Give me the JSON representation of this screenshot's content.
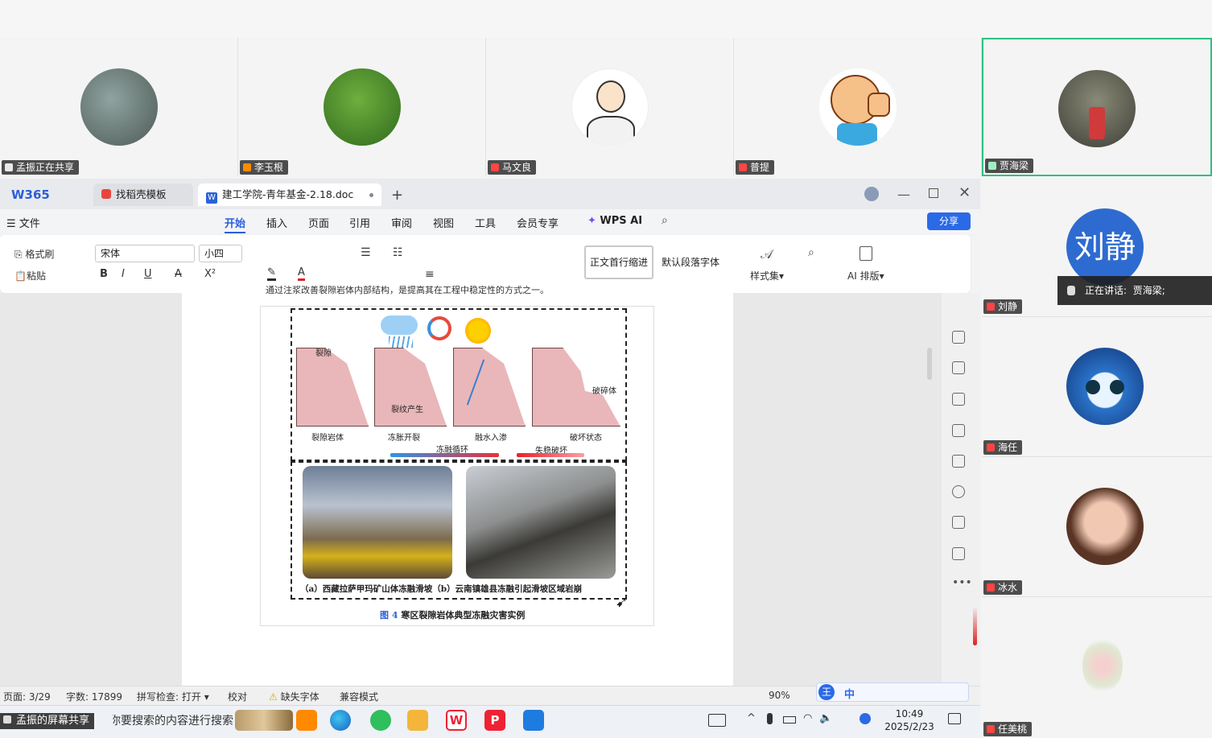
{
  "participants_top": [
    {
      "name": "孟振正在共享",
      "mic": "share"
    },
    {
      "name": "李玉根",
      "mic": "orange"
    },
    {
      "name": "马文良",
      "mic": "red"
    },
    {
      "name": "普提",
      "mic": "red"
    },
    {
      "name": "贾海梁",
      "mic": "off"
    }
  ],
  "participants_right": [
    {
      "name": "刘静",
      "avatar_text": "刘静"
    },
    {
      "name": "海任"
    },
    {
      "name": "冰水"
    },
    {
      "name": "任美桃"
    }
  ],
  "speaking": {
    "label": "正在讲话:",
    "name": "贾海梁;"
  },
  "tabs": {
    "home": "W365",
    "template": "找稻壳模板",
    "doc": "建工学院-青年基金-2.18.doc"
  },
  "menu": {
    "file": "文件",
    "items": [
      "开始",
      "插入",
      "页面",
      "引用",
      "审阅",
      "视图",
      "工具",
      "会员专享"
    ],
    "ai": "WPS AI",
    "share": "分享"
  },
  "toolbar": {
    "format_painter": "格式刷",
    "paste": "粘贴",
    "font_name": "宋体",
    "font_size": "小四",
    "style1": "正文首行缩进",
    "style2": "默认段落字体",
    "style_set": "样式集",
    "ai_layout": "AI 排版"
  },
  "figure": {
    "labels_top": [
      "裂隙",
      "裂纹产生",
      "破碎体"
    ],
    "stages": [
      "裂隙岩体",
      "冻胀开裂",
      "融水入渗",
      "破坏状态"
    ],
    "arrow1": "冻融循环",
    "arrow2": "失稳破坏",
    "photo_caption": "（a）西藏拉萨甲玛矿山体冻融滑坡（b）云南镇雄县冻融引起滑坡区域岩崩",
    "caption_num": "图 4",
    "caption_text": "寒区裂隙岩体典型冻融灾害实例"
  },
  "doc_top_text": "通过注浆改善裂隙岩体内部结构，是提高其在工程中稳定性的方式之一。",
  "status": {
    "page": "页面: 3/29",
    "words": "字数: 17899",
    "spell": "拼写检查: 打开",
    "proof": "校对",
    "missing_font": "缺失字体",
    "compat": "兼容模式",
    "zoom": "90%"
  },
  "taskbar": {
    "search": "在这里输入你要搜索的内容进行搜索",
    "share_label": "孟振的屏幕共享",
    "time": "10:49",
    "date": "2025/2/23"
  },
  "ime": {
    "label1": "王",
    "label2": "中"
  }
}
